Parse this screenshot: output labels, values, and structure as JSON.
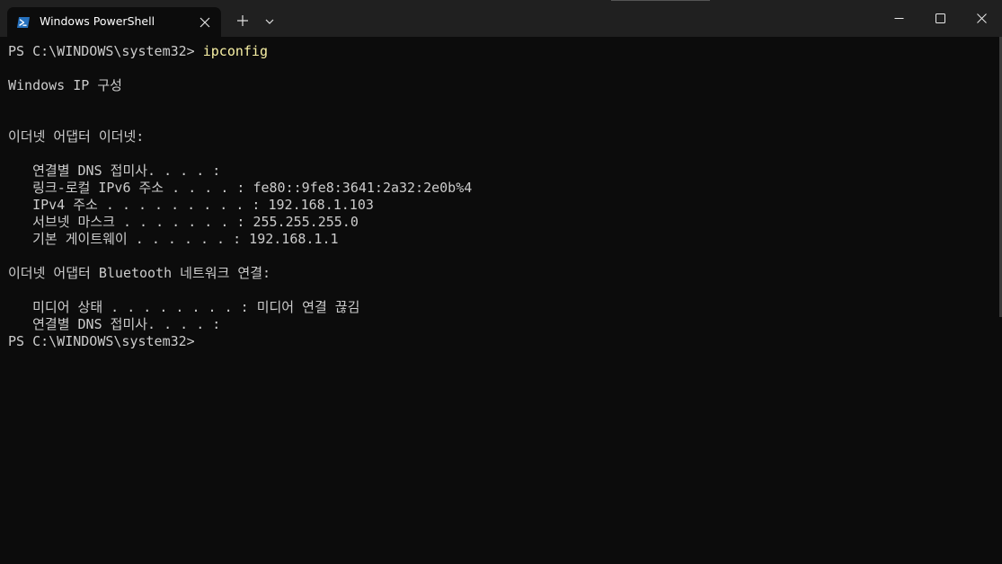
{
  "window": {
    "tab_title": "Windows PowerShell"
  },
  "icons": {
    "tab": "powershell-icon",
    "close_tab": "close-icon",
    "new_tab": "plus-icon",
    "dropdown": "chevron-down-icon",
    "minimize": "minimize-icon",
    "maximize": "maximize-icon",
    "close": "close-icon"
  },
  "colors": {
    "background": "#0c0c0c",
    "titlebar": "#202020",
    "text": "#cccccc",
    "command": "#f9f1a5"
  },
  "terminal": {
    "prompt1": "PS C:\\WINDOWS\\system32> ",
    "command1": "ipconfig",
    "header": "Windows IP 구성",
    "adapter1_header": "이더넷 어댑터 이더넷:",
    "adapter1_lines": [
      "   연결별 DNS 접미사. . . . :",
      "   링크-로컬 IPv6 주소 . . . . : fe80::9fe8:3641:2a32:2e0b%4",
      "   IPv4 주소 . . . . . . . . . : 192.168.1.103",
      "   서브넷 마스크 . . . . . . . : 255.255.255.0",
      "   기본 게이트웨이 . . . . . . : 192.168.1.1"
    ],
    "adapter2_header": "이더넷 어댑터 Bluetooth 네트워크 연결:",
    "adapter2_lines": [
      "   미디어 상태 . . . . . . . . : 미디어 연결 끊김",
      "   연결별 DNS 접미사. . . . :"
    ],
    "prompt2": "PS C:\\WINDOWS\\system32>"
  }
}
